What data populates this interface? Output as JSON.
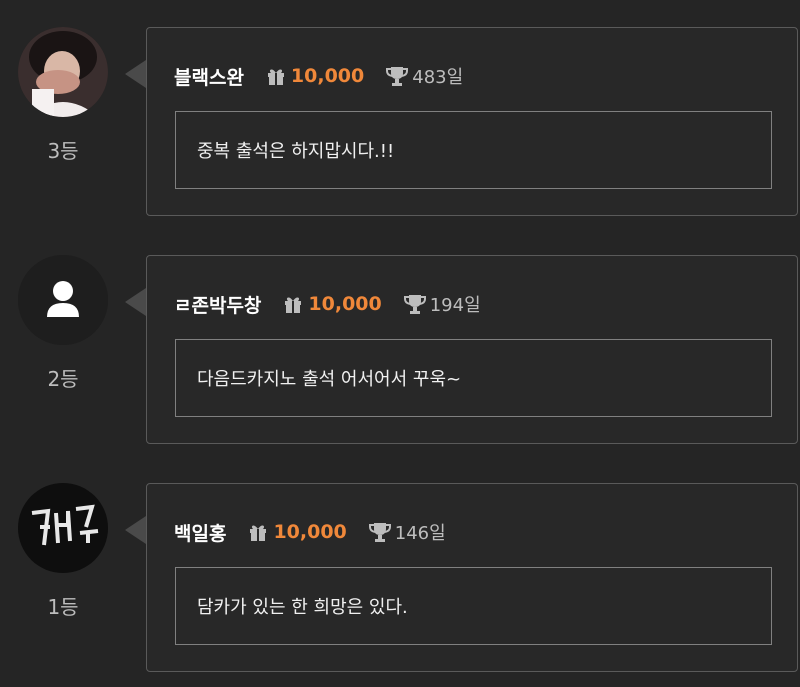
{
  "colors": {
    "background": "#252525",
    "card_border": "#5a5a5a",
    "accent_points": "#f0883a"
  },
  "icons": {
    "gift": "gift-icon",
    "trophy": "trophy-icon",
    "default_avatar": "user-silhouette-icon"
  },
  "entries": [
    {
      "rank": "3등",
      "nickname": "블랙스완",
      "points": "10,000",
      "days": "483일",
      "message": "중복 출석은 하지맙시다.!!",
      "avatar": "photo"
    },
    {
      "rank": "2등",
      "nickname": "ㄹ존박두창",
      "points": "10,000",
      "days": "194일",
      "message": "다음드카지노 출석 어서어서 꾸욱~",
      "avatar": "default"
    },
    {
      "rank": "1등",
      "nickname": "백일홍",
      "points": "10,000",
      "days": "146일",
      "message": "담카가 있는 한 희망은 있다.",
      "avatar": "photo"
    }
  ]
}
